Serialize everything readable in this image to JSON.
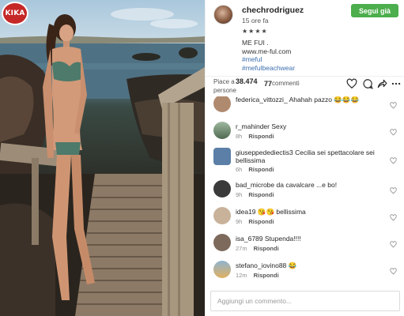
{
  "badge": {
    "text": "KIKA"
  },
  "post": {
    "username": "chechrodriguez",
    "time_ago": "15 ore fa",
    "stars": "★★★★",
    "caption_line1": "ME FUI .",
    "caption_line2": "www.me-ful.com",
    "hashtag1": "#meful",
    "hashtag2": "#mefulbeachwear",
    "follow_label": "Segui già"
  },
  "stats": {
    "likes_prefix": "Piace a",
    "likes_count": "38.474",
    "likes_suffix": "persone",
    "comments_count": "77",
    "comments_label": "commenti"
  },
  "actions": [
    "heart-icon",
    "comment-icon",
    "share-icon",
    "more-icon"
  ],
  "comments": [
    {
      "user": "federica_vittozzi_",
      "text": "Ahahah pazzo 😂😂😂",
      "time": "",
      "reply": "Rispondi"
    },
    {
      "user": "r_mahinder",
      "text": "Sexy",
      "time": "8h",
      "reply": "Rispondi"
    },
    {
      "user": "giuseppedediectis3",
      "text": "Cecilia sei spettacolare sei bellissima",
      "time": "6h",
      "reply": "Rispondi"
    },
    {
      "user": "bad_microbe",
      "text": "da cavalcare ...e bo!",
      "time": "9h",
      "reply": "Rispondi"
    },
    {
      "user": "idea19",
      "text": "😘😘 bellissima",
      "time": "9h",
      "reply": "Rispondi"
    },
    {
      "user": "isa_6789",
      "text": "Stupenda!!!!",
      "time": "27m",
      "reply": "Rispondi"
    },
    {
      "user": "stefano_iovino88",
      "text": "😂",
      "time": "12m",
      "reply": "Rispondi"
    }
  ],
  "add_comment_placeholder": "Aggiungi un commento..."
}
